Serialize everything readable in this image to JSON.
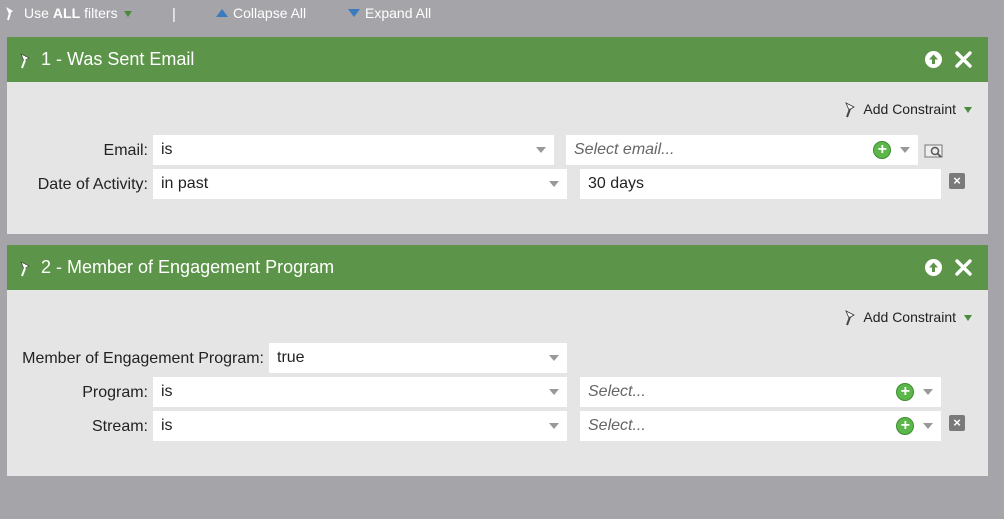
{
  "toolbar": {
    "use_prefix": "Use",
    "use_all": "ALL",
    "use_suffix": "filters",
    "separator": "|",
    "collapse": "Collapse All",
    "expand": "Expand All"
  },
  "filters": [
    {
      "title": "1 - Was Sent Email",
      "add_constraint": "Add Constraint",
      "rows": [
        {
          "label": "Email:",
          "operator": "is",
          "value_placeholder": "Select email..."
        },
        {
          "label": "Date of Activity:",
          "operator": "in past",
          "value": "30 days"
        }
      ]
    },
    {
      "title": "2 - Member of Engagement Program",
      "add_constraint": "Add Constraint",
      "rows": [
        {
          "label": "Member of Engagement Program:",
          "operator": "true"
        },
        {
          "label": "Program:",
          "operator": "is",
          "value_placeholder": "Select..."
        },
        {
          "label": "Stream:",
          "operator": "is",
          "value_placeholder": "Select..."
        }
      ]
    }
  ],
  "colors": {
    "header_green": "#5c9549",
    "panel_bg": "#e5e5e5",
    "page_bg": "#a5a4a9",
    "plus_green": "#5cb74a"
  },
  "icons": [
    "filter-wand-icon",
    "chevron-up-circle-icon",
    "close-icon",
    "plus-circle-icon",
    "lookup-icon",
    "delete-box-icon"
  ]
}
